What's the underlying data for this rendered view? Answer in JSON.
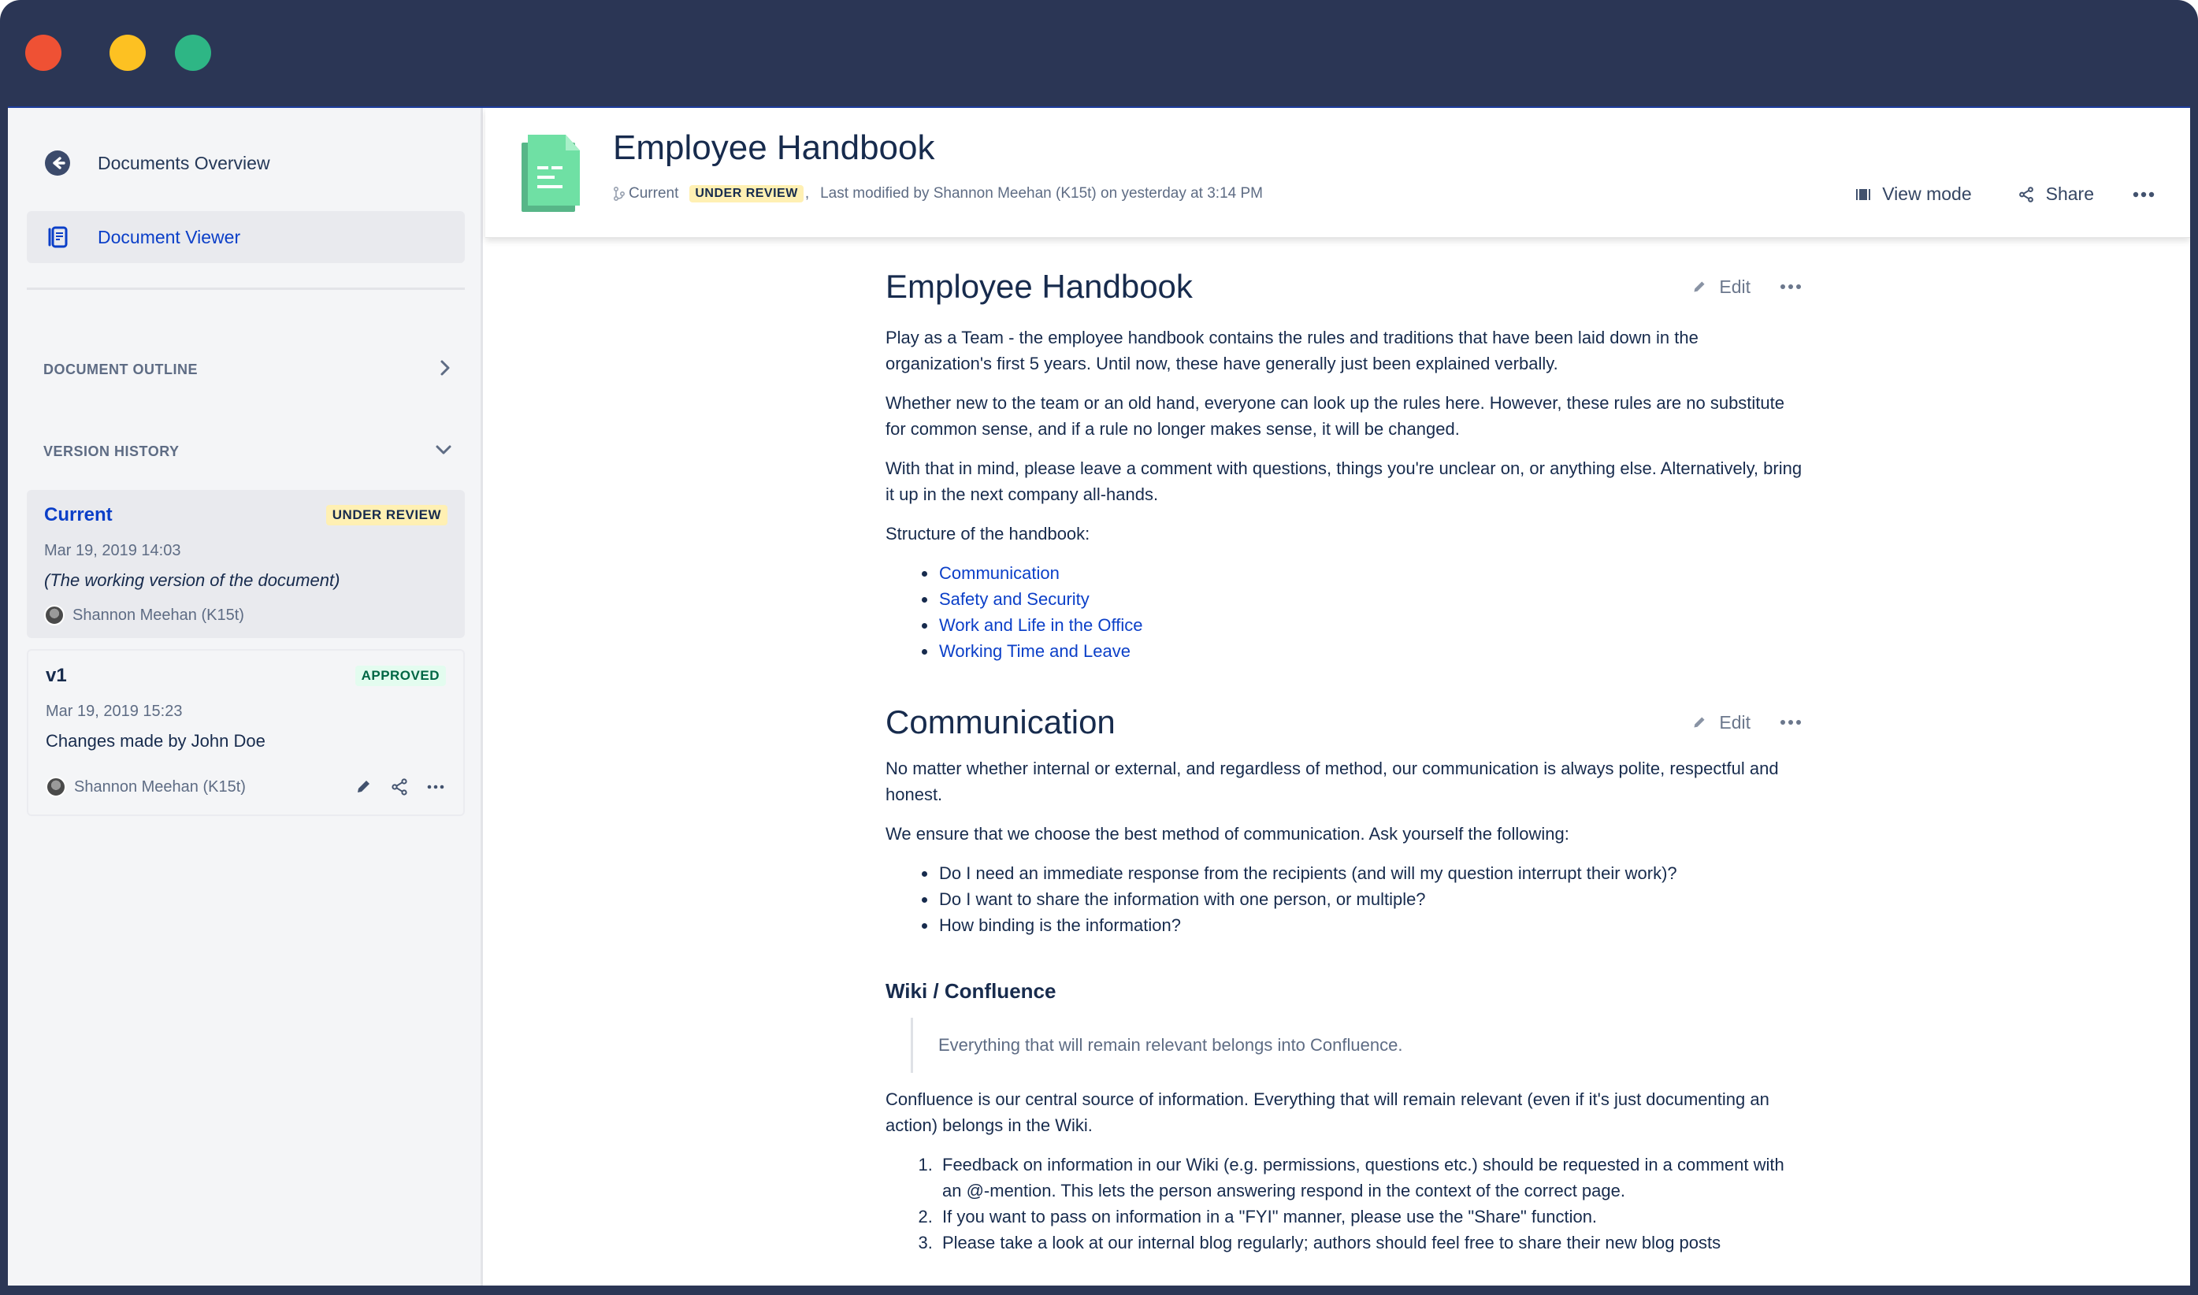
{
  "window": {
    "controls": [
      "close",
      "minimize",
      "maximize"
    ],
    "colors": {
      "frame": "#2b3655",
      "close": "#ef5134",
      "minimize": "#fdc122",
      "maximize": "#2eb685"
    }
  },
  "sidebar": {
    "nav": [
      {
        "label": "Documents Overview",
        "icon": "arrow-left-circle-icon"
      },
      {
        "label": "Document Viewer",
        "icon": "document-viewer-icon",
        "active": true
      }
    ],
    "outline": {
      "label": "DOCUMENT OUTLINE",
      "icon": "chevron-right-icon"
    },
    "history": {
      "label": "VERSION HISTORY",
      "icon": "chevron-down-icon",
      "versions": [
        {
          "title": "Current",
          "status": "UNDER REVIEW",
          "date": "Mar 19, 2019 14:03",
          "description": "(The working version of the document)",
          "author": "Shannon Meehan (K15t)"
        },
        {
          "title": "v1",
          "status": "APPROVED",
          "date": "Mar 19, 2019 15:23",
          "description": "Changes made by John Doe",
          "author": "Shannon Meehan (K15t)",
          "actions": [
            "edit-icon",
            "share-icon",
            "more-icon"
          ]
        }
      ]
    }
  },
  "header": {
    "title": "Employee Handbook",
    "branch": "Current",
    "status": "UNDER REVIEW",
    "comma": ",",
    "modified": "Last modified by Shannon Meehan (K15t) on yesterday at 3:14 PM",
    "view_mode": "View mode",
    "share": "Share"
  },
  "content": {
    "edit_label": "Edit",
    "sections": {
      "intro": {
        "heading": "Employee Handbook",
        "paragraphs": [
          "Play as a Team - the employee handbook contains the rules and traditions that have been laid down in the organization's first 5 years. Until now, these have generally just been explained verbally.",
          "Whether new to the team or an old hand, everyone can look up the rules here. However, these rules are no substitute for common sense, and if a rule no longer makes sense, it will be changed.",
          "With that in mind, please leave a comment with questions, things you're unclear on, or anything else. Alternatively, bring it up in the next company all-hands.",
          "Structure of the handbook:"
        ],
        "links": [
          "Communication",
          "Safety and Security",
          "Work and Life in the Office",
          "Working Time and Leave"
        ]
      },
      "communication": {
        "heading": "Communication",
        "paragraphs": [
          "No matter whether internal or external, and regardless of method, our communication is always polite, respectful and honest.",
          "We ensure that we choose the best method of communication. Ask yourself the following:"
        ],
        "questions": [
          "Do I need an immediate response from the recipients (and will my question interrupt their work)?",
          "Do I want to share the information with one person, or multiple?",
          "How binding is the information?"
        ]
      },
      "wiki": {
        "heading": "Wiki / Confluence",
        "quote": "Everything that will remain relevant belongs into Confluence.",
        "paragraph": "Confluence is our central source of information. Everything that will remain relevant (even if it's just documenting an action) belongs in the Wiki.",
        "rules": [
          "Feedback on information in our Wiki (e.g. permissions, questions etc.) should be requested in a comment with an @-mention. This lets the person answering respond in the context of the correct page.",
          "If you want to pass on information in a \"FYI\" manner, please use the \"Share\" function.",
          "Please take a look at our internal blog regularly; authors should feel free to share their new blog posts"
        ]
      }
    }
  }
}
